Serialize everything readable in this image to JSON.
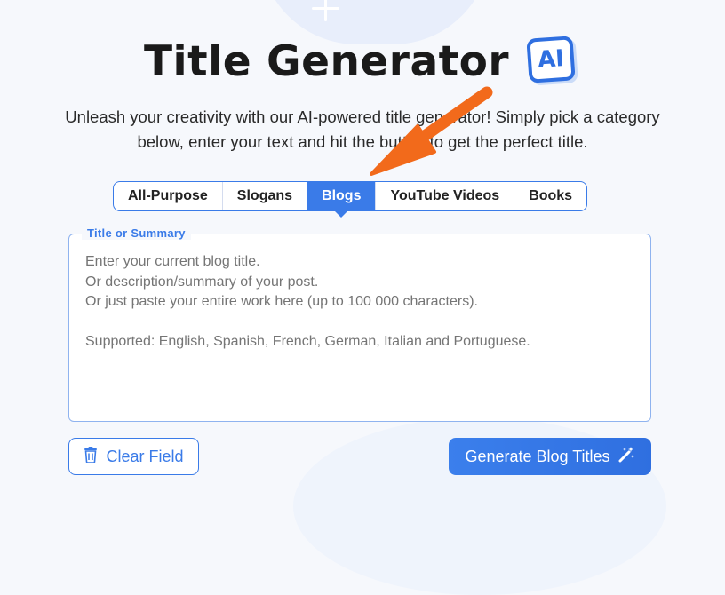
{
  "header": {
    "title": "Title Generator",
    "badge": "AI",
    "subtitle": "Unleash your creativity with our AI-powered title generator! Simply pick a category below, enter your text and hit the button to get the perfect title."
  },
  "tabs": [
    {
      "label": "All-Purpose",
      "active": false
    },
    {
      "label": "Slogans",
      "active": false
    },
    {
      "label": "Blogs",
      "active": true
    },
    {
      "label": "YouTube Videos",
      "active": false
    },
    {
      "label": "Books",
      "active": false
    }
  ],
  "input": {
    "legend": "Title or Summary",
    "value": "",
    "placeholder": "Enter your current blog title.\nOr description/summary of your post.\nOr just paste your entire work here (up to 100 000 characters).\n\nSupported: English, Spanish, French, German, Italian and Portuguese."
  },
  "actions": {
    "clear_label": "Clear Field",
    "generate_label": "Generate Blog Titles"
  },
  "icons": {
    "clear": "trash-icon",
    "generate": "magic-wand-icon"
  },
  "colors": {
    "accent": "#3a7be8",
    "annotation_arrow": "#f26a1b"
  }
}
